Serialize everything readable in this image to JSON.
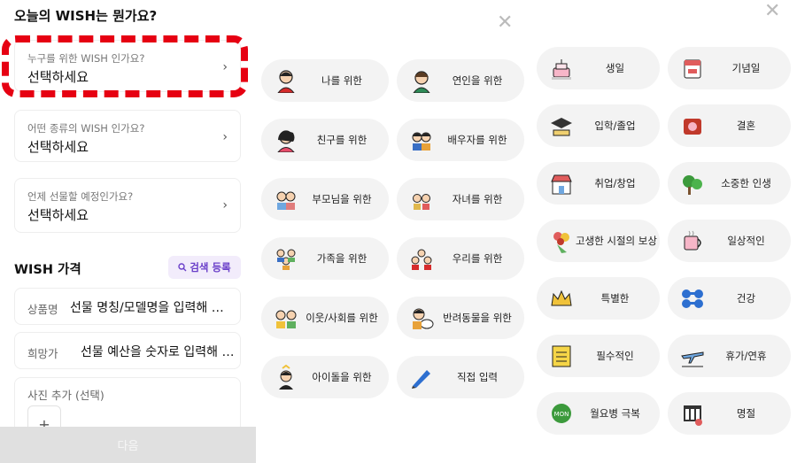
{
  "screen1": {
    "title": "오늘의 WISH는 뭔가요?",
    "questions": [
      {
        "label": "누구를 위한 WISH 인가요?",
        "value": "선택하세요"
      },
      {
        "label": "어떤 종류의 WISH 인가요?",
        "value": "선택하세요"
      },
      {
        "label": "언제 선물할 예정인가요?",
        "value": "선택하세요"
      }
    ],
    "price_section_title": "WISH 가격",
    "search_button": "검색 등록",
    "product_label": "상품명",
    "product_placeholder": "선물 명칭/모델명을 입력해 …",
    "price_label": "희망가",
    "price_placeholder": "선물 예산을 숫자로 입력해 …",
    "photo_label": "사진 추가 (선택)",
    "photo_add": "+",
    "next_button": "다음",
    "highlight_color": "#e60012",
    "accent_color": "#6a3fc9"
  },
  "screen2": {
    "close": "✕",
    "options": [
      {
        "label": "나를 위한",
        "icon": "person-red-icon"
      },
      {
        "label": "연인을 위한",
        "icon": "lover-icon"
      },
      {
        "label": "친구를 위한",
        "icon": "friend-icon"
      },
      {
        "label": "배우자를 위한",
        "icon": "spouse-icon"
      },
      {
        "label": "부모님을 위한",
        "icon": "parents-icon"
      },
      {
        "label": "자녀를 위한",
        "icon": "children-icon"
      },
      {
        "label": "가족을 위한",
        "icon": "family-icon"
      },
      {
        "label": "우리를 위한",
        "icon": "us-icon"
      },
      {
        "label": "이웃/사회를 위한",
        "icon": "neighbor-icon"
      },
      {
        "label": "반려동물을 위한",
        "icon": "pet-icon"
      },
      {
        "label": "아이돌을 위한",
        "icon": "idol-icon"
      },
      {
        "label": "직접 입력",
        "icon": "pencil-icon"
      }
    ]
  },
  "screen3": {
    "close": "✕",
    "options": [
      {
        "label": "생일",
        "icon": "cake-icon"
      },
      {
        "label": "기념일",
        "icon": "calendar-icon"
      },
      {
        "label": "입학/졸업",
        "icon": "graduation-cap-icon"
      },
      {
        "label": "결혼",
        "icon": "wedding-icon"
      },
      {
        "label": "취업/창업",
        "icon": "store-icon"
      },
      {
        "label": "소중한 인생",
        "icon": "tree-icon"
      },
      {
        "label": "고생한 시절의 보상",
        "icon": "bouquet-icon"
      },
      {
        "label": "일상적인",
        "icon": "mug-icon"
      },
      {
        "label": "특별한",
        "icon": "crown-icon"
      },
      {
        "label": "건강",
        "icon": "dumbbell-icon"
      },
      {
        "label": "필수적인",
        "icon": "checklist-icon"
      },
      {
        "label": "휴가/연휴",
        "icon": "airplane-icon"
      },
      {
        "label": "월요병 극복",
        "icon": "monday-icon"
      },
      {
        "label": "명절",
        "icon": "holiday-icon"
      }
    ]
  }
}
